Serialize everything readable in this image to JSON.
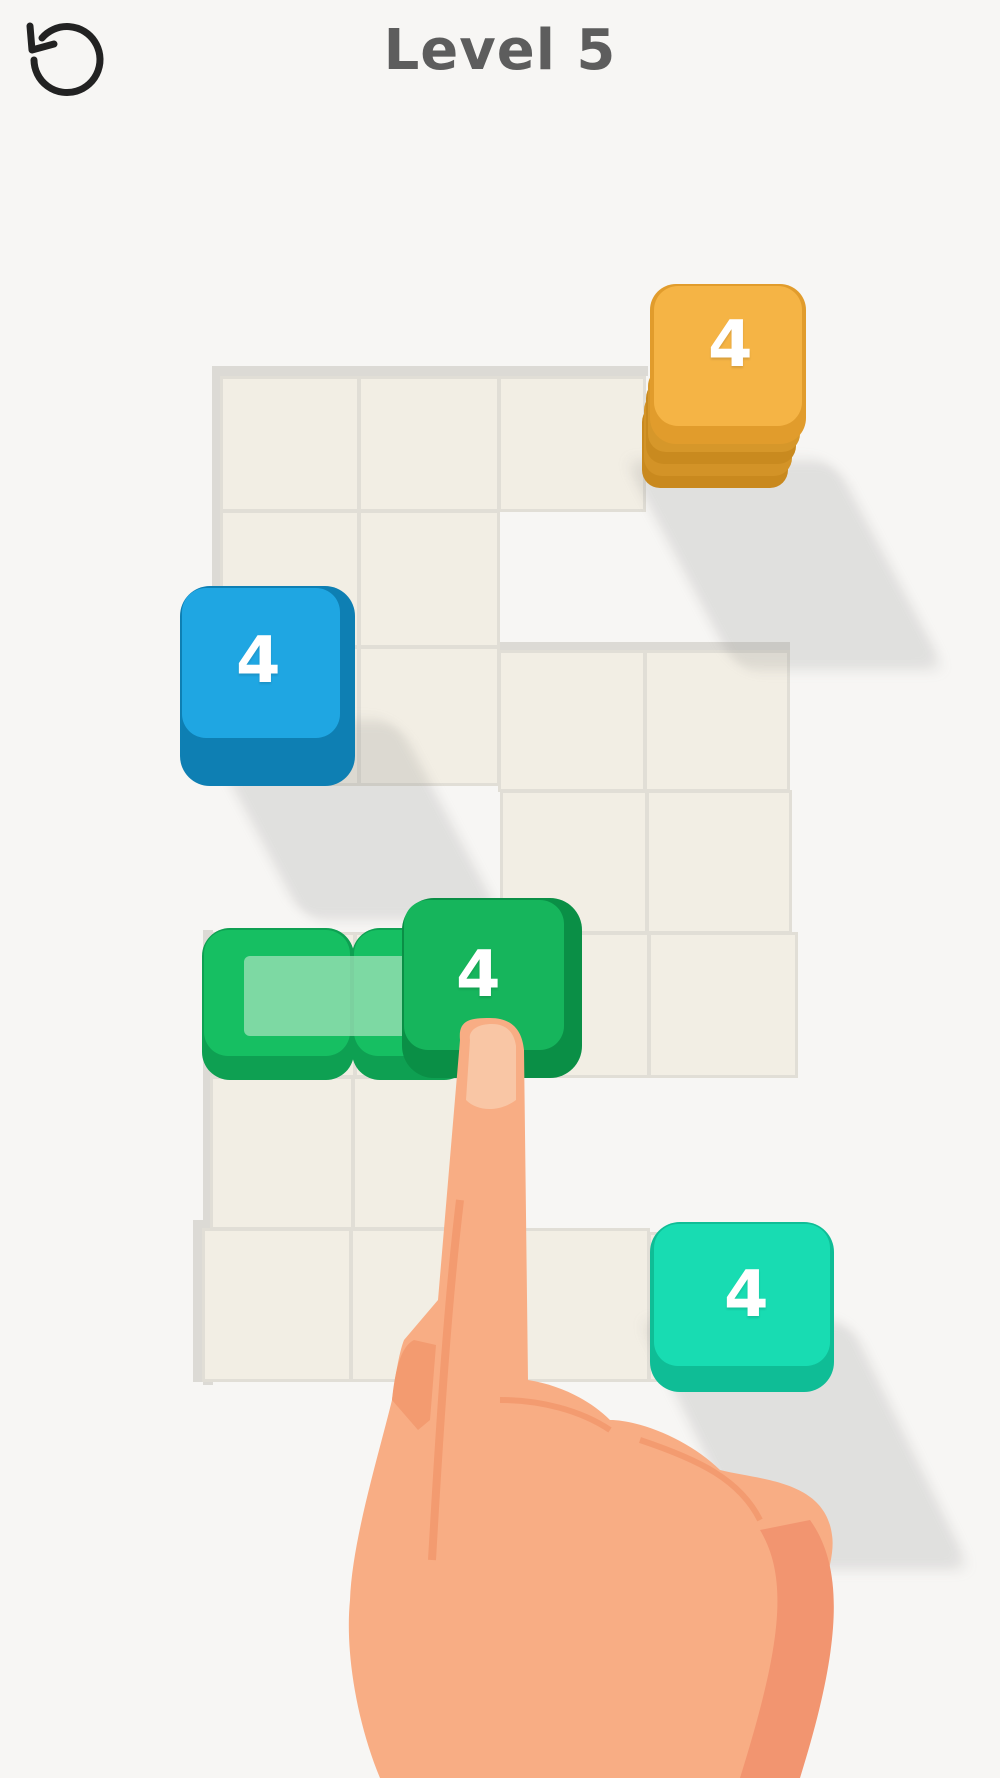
{
  "header": {
    "title": "Level 5",
    "restart_icon": "restart-icon"
  },
  "board": {
    "cell_color": "#f2eee4",
    "grid_color": "#e1ded6"
  },
  "blocks": [
    {
      "id": "orange",
      "value": "4",
      "color": "#f0a83a",
      "stack_layers": 6
    },
    {
      "id": "blue",
      "value": "4",
      "color": "#1ea0dc",
      "stack_layers": 1
    },
    {
      "id": "green",
      "value": "4",
      "color": "#13b25c",
      "stack_layers": 1
    },
    {
      "id": "teal",
      "value": "4",
      "color": "#16d8ae",
      "stack_layers": 1
    }
  ],
  "tutorial": {
    "hand_icon": "pointing-hand-icon",
    "hand_color": "#f8ad84"
  }
}
